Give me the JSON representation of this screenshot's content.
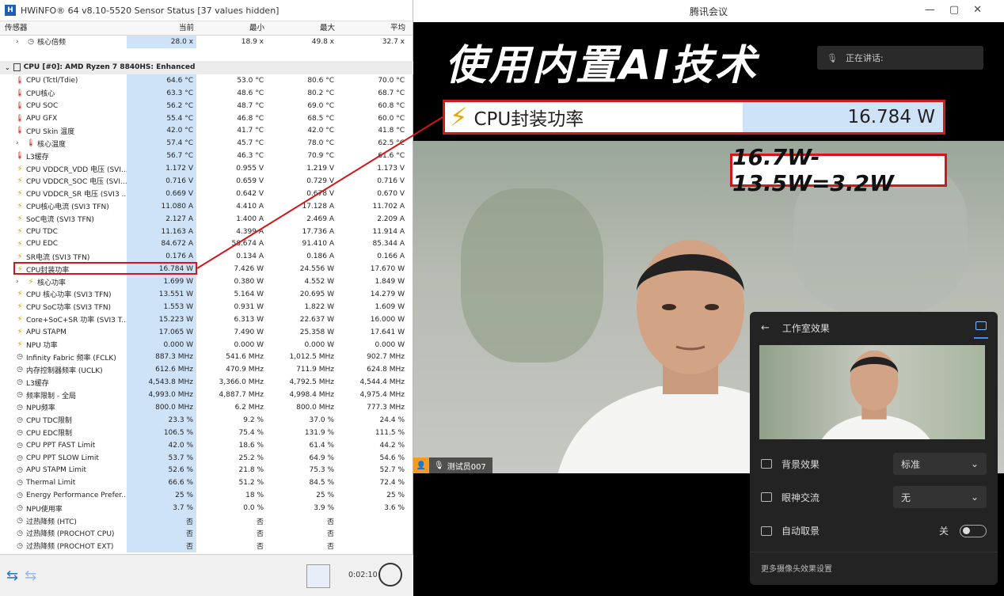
{
  "hwinfo": {
    "title": "HWiNFO® 64 v8.10-5520 Sensor Status [37 values hidden]",
    "columns": {
      "sensor": "传感器",
      "current": "当前",
      "min": "最小",
      "max": "最大",
      "avg": "平均"
    },
    "top_row": {
      "label": "核心倍频",
      "cur": "28.0 x",
      "min": "18.9 x",
      "max": "49.8 x",
      "avg": "32.7 x"
    },
    "group": "CPU [#0]: AMD Ryzen 7 8840HS: Enhanced",
    "rows": [
      {
        "icon": "thermometer",
        "label": "CPU (Tctl/Tdie)",
        "cur": "64.6 °C",
        "min": "53.0 °C",
        "max": "80.6 °C",
        "avg": "70.0 °C"
      },
      {
        "icon": "thermometer",
        "label": "CPU核心",
        "cur": "63.3 °C",
        "min": "48.6 °C",
        "max": "80.2 °C",
        "avg": "68.7 °C"
      },
      {
        "icon": "thermometer",
        "label": "CPU SOC",
        "cur": "56.2 °C",
        "min": "48.7 °C",
        "max": "69.0 °C",
        "avg": "60.8 °C"
      },
      {
        "icon": "thermometer",
        "label": "APU GFX",
        "cur": "55.4 °C",
        "min": "46.8 °C",
        "max": "68.5 °C",
        "avg": "60.0 °C"
      },
      {
        "icon": "thermometer",
        "label": "CPU Skin 温度",
        "cur": "42.0 °C",
        "min": "41.7 °C",
        "max": "42.0 °C",
        "avg": "41.8 °C"
      },
      {
        "icon": "thermometer",
        "label": "核心温度",
        "cur": "57.4 °C",
        "min": "45.7 °C",
        "max": "78.0 °C",
        "avg": "62.5 °C",
        "expand": true
      },
      {
        "icon": "thermometer",
        "label": "L3缓存",
        "cur": "56.7 °C",
        "min": "46.3 °C",
        "max": "70.9 °C",
        "avg": "61.6 °C"
      },
      {
        "icon": "bolt",
        "label": "CPU VDDCR_VDD 电压 (SVI...",
        "cur": "1.172 V",
        "min": "0.955 V",
        "max": "1.219 V",
        "avg": "1.173 V"
      },
      {
        "icon": "bolt",
        "label": "CPU VDDCR_SOC 电压 (SVI...",
        "cur": "0.716 V",
        "min": "0.659 V",
        "max": "0.729 V",
        "avg": "0.716 V"
      },
      {
        "icon": "bolt",
        "label": "CPU VDDCR_SR 电压 (SVI3 ...",
        "cur": "0.669 V",
        "min": "0.642 V",
        "max": "0.678 V",
        "avg": "0.670 V"
      },
      {
        "icon": "bolt",
        "label": "CPU核心电流 (SVI3 TFN)",
        "cur": "11.080 A",
        "min": "4.410 A",
        "max": "17.128 A",
        "avg": "11.702 A"
      },
      {
        "icon": "bolt",
        "label": "SoC电流 (SVI3 TFN)",
        "cur": "2.127 A",
        "min": "1.400 A",
        "max": "2.469 A",
        "avg": "2.209 A"
      },
      {
        "icon": "bolt",
        "label": "CPU TDC",
        "cur": "11.163 A",
        "min": "4.399 A",
        "max": "17.736 A",
        "avg": "11.914 A"
      },
      {
        "icon": "bolt",
        "label": "CPU EDC",
        "cur": "84.672 A",
        "min": "58.674 A",
        "max": "91.410 A",
        "avg": "85.344 A"
      },
      {
        "icon": "bolt",
        "label": "SR电流 (SVI3 TFN)",
        "cur": "0.176 A",
        "min": "0.134 A",
        "max": "0.186 A",
        "avg": "0.166 A"
      },
      {
        "icon": "bolt",
        "label": "CPU封装功率",
        "cur": "16.784 W",
        "min": "7.426 W",
        "max": "24.556 W",
        "avg": "17.670 W"
      },
      {
        "icon": "bolt",
        "label": "核心功率",
        "cur": "1.699 W",
        "min": "0.380 W",
        "max": "4.552 W",
        "avg": "1.849 W",
        "expand": true
      },
      {
        "icon": "bolt",
        "label": "CPU 核心功率 (SVI3 TFN)",
        "cur": "13.551 W",
        "min": "5.164 W",
        "max": "20.695 W",
        "avg": "14.279 W"
      },
      {
        "icon": "bolt",
        "label": "CPU SoC功率 (SVI3 TFN)",
        "cur": "1.553 W",
        "min": "0.931 W",
        "max": "1.822 W",
        "avg": "1.609 W"
      },
      {
        "icon": "bolt",
        "label": "Core+SoC+SR 功率 (SVI3 T...",
        "cur": "15.223 W",
        "min": "6.313 W",
        "max": "22.637 W",
        "avg": "16.000 W"
      },
      {
        "icon": "bolt",
        "label": "APU STAPM",
        "cur": "17.065 W",
        "min": "7.490 W",
        "max": "25.358 W",
        "avg": "17.641 W"
      },
      {
        "icon": "bolt",
        "label": "NPU 功率",
        "cur": "0.000 W",
        "min": "0.000 W",
        "max": "0.000 W",
        "avg": "0.000 W"
      },
      {
        "icon": "clock",
        "label": "Infinity Fabric 频率 (FCLK)",
        "cur": "887.3 MHz",
        "min": "541.6 MHz",
        "max": "1,012.5 MHz",
        "avg": "902.7 MHz"
      },
      {
        "icon": "clock",
        "label": "内存控制器频率 (UCLK)",
        "cur": "612.6 MHz",
        "min": "470.9 MHz",
        "max": "711.9 MHz",
        "avg": "624.8 MHz"
      },
      {
        "icon": "clock",
        "label": "L3缓存",
        "cur": "4,543.8 MHz",
        "min": "3,366.0 MHz",
        "max": "4,792.5 MHz",
        "avg": "4,544.4 MHz"
      },
      {
        "icon": "clock",
        "label": "频率限制 - 全局",
        "cur": "4,993.0 MHz",
        "min": "4,887.7 MHz",
        "max": "4,998.4 MHz",
        "avg": "4,975.4 MHz"
      },
      {
        "icon": "clock",
        "label": "NPU频率",
        "cur": "800.0 MHz",
        "min": "6.2 MHz",
        "max": "800.0 MHz",
        "avg": "777.3 MHz"
      },
      {
        "icon": "clock",
        "label": "CPU TDC限制",
        "cur": "23.3 %",
        "min": "9.2 %",
        "max": "37.0 %",
        "avg": "24.4 %"
      },
      {
        "icon": "clock",
        "label": "CPU EDC限制",
        "cur": "106.5 %",
        "min": "75.4 %",
        "max": "131.9 %",
        "avg": "111.5 %"
      },
      {
        "icon": "clock",
        "label": "CPU PPT FAST Limit",
        "cur": "42.0 %",
        "min": "18.6 %",
        "max": "61.4 %",
        "avg": "44.2 %"
      },
      {
        "icon": "clock",
        "label": "CPU PPT SLOW Limit",
        "cur": "53.7 %",
        "min": "25.2 %",
        "max": "64.9 %",
        "avg": "54.6 %"
      },
      {
        "icon": "clock",
        "label": "APU STAPM Limit",
        "cur": "52.6 %",
        "min": "21.8 %",
        "max": "75.3 %",
        "avg": "52.7 %"
      },
      {
        "icon": "clock",
        "label": "Thermal Limit",
        "cur": "66.6 %",
        "min": "51.2 %",
        "max": "84.5 %",
        "avg": "72.4 %"
      },
      {
        "icon": "clock",
        "label": "Energy Performance Prefer...",
        "cur": "25 %",
        "min": "18 %",
        "max": "25 %",
        "avg": "25 %"
      },
      {
        "icon": "clock",
        "label": "NPU使用率",
        "cur": "3.7 %",
        "min": "0.0 %",
        "max": "3.9 %",
        "avg": "3.6 %"
      },
      {
        "icon": "clock",
        "label": "过热降频 (HTC)",
        "cur": "否",
        "min": "否",
        "max": "否",
        "avg": ""
      },
      {
        "icon": "clock",
        "label": "过热降频 (PROCHOT CPU)",
        "cur": "否",
        "min": "否",
        "max": "否",
        "avg": ""
      },
      {
        "icon": "clock",
        "label": "过热降频 (PROCHOT EXT)",
        "cur": "否",
        "min": "否",
        "max": "否",
        "avg": ""
      }
    ],
    "elapsed": "0:02:10"
  },
  "meeting": {
    "title": "腾讯会议",
    "headline": "使用内置AI技术",
    "speaking_label": "正在讲话:",
    "callout_name": "CPU封装功率",
    "callout_value": "16.784 W",
    "formula": "16.7W-13.5W=3.2W",
    "participant": "测试员007",
    "panel": {
      "title": "工作室效果",
      "bg_label": "背景效果",
      "bg_value": "标准",
      "eye_label": "眼神交流",
      "eye_value": "无",
      "frame_label": "自动取景",
      "frame_state": "关",
      "more": "更多摄像头效果设置"
    }
  }
}
